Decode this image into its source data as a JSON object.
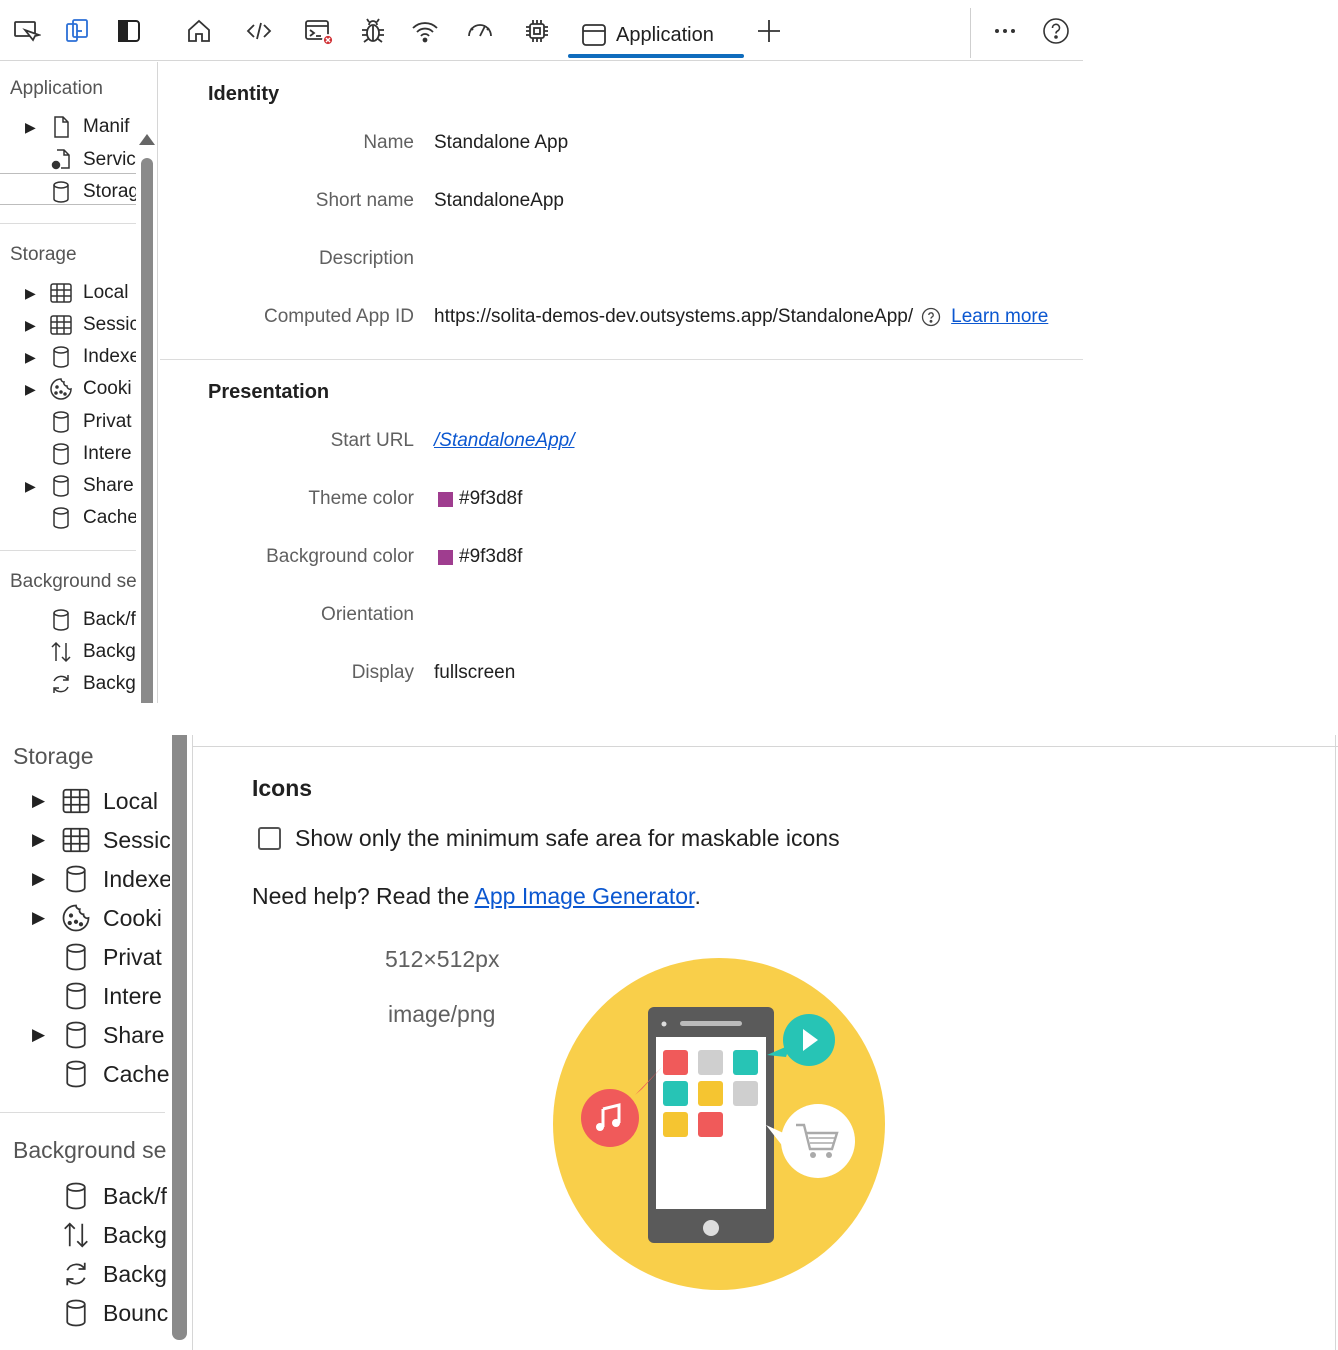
{
  "toolbar": {
    "active_tab_label": "Application",
    "icons": [
      "inspect-icon",
      "device-emulation-icon",
      "dock-sidebar-icon",
      "welcome-home-icon",
      "elements-code-icon",
      "console-icon",
      "sources-bug-icon",
      "network-wifi-icon",
      "performance-gauge-icon",
      "memory-chip-icon",
      "application-window-icon",
      "add-tab-icon",
      "more-options-icon",
      "help-icon"
    ]
  },
  "sidebar": {
    "sections": [
      {
        "heading": "Application",
        "items": [
          {
            "label": "Manif",
            "icon": "document-icon",
            "expandable": true
          },
          {
            "label": "Servic",
            "icon": "service-worker-icon",
            "expandable": false
          },
          {
            "label": "Storag",
            "icon": "database-icon",
            "expandable": false
          }
        ]
      },
      {
        "heading": "Storage",
        "items": [
          {
            "label": "Local",
            "icon": "grid-table-icon",
            "expandable": true
          },
          {
            "label": "Sessic",
            "icon": "grid-table-icon",
            "expandable": true
          },
          {
            "label": "Indexe",
            "icon": "database-icon",
            "expandable": true
          },
          {
            "label": "Cooki",
            "icon": "cookie-icon",
            "expandable": true
          },
          {
            "label": "Privat",
            "icon": "database-icon",
            "expandable": false
          },
          {
            "label": "Intere",
            "icon": "database-icon",
            "expandable": false
          },
          {
            "label": "Share",
            "icon": "database-icon",
            "expandable": true
          },
          {
            "label": "Cache",
            "icon": "database-icon",
            "expandable": false
          }
        ]
      },
      {
        "heading": "Background se",
        "items": [
          {
            "label": "Back/f",
            "icon": "database-icon",
            "expandable": false
          },
          {
            "label": "Backg",
            "icon": "up-down-arrows-icon",
            "expandable": false
          },
          {
            "label": "Backg",
            "icon": "sync-icon",
            "expandable": false
          },
          {
            "label": "Bounc",
            "icon": "database-icon",
            "expandable": false
          }
        ]
      }
    ]
  },
  "identity": {
    "title": "Identity",
    "name_label": "Name",
    "name_value": "Standalone App",
    "short_name_label": "Short name",
    "short_name_value": "StandaloneApp",
    "description_label": "Description",
    "description_value": "",
    "app_id_label": "Computed App ID",
    "app_id_value": "https://solita-demos-dev.outsystems.app/StandaloneApp/",
    "learn_more": "Learn more"
  },
  "presentation": {
    "title": "Presentation",
    "start_url_label": "Start URL",
    "start_url_value": "/StandaloneApp/",
    "theme_color_label": "Theme color",
    "theme_color_value": "#9f3d8f",
    "background_color_label": "Background color",
    "background_color_value": "#9f3d8f",
    "orientation_label": "Orientation",
    "orientation_value": "",
    "display_label": "Display",
    "display_value": "fullscreen"
  },
  "icons_section": {
    "title": "Icons",
    "checkbox_label": "Show only the minimum safe area for maskable icons",
    "checkbox_checked": false,
    "help_prefix": "Need help? Read the ",
    "help_link": "App Image Generator",
    "help_suffix": ".",
    "icon_size": "512×512px",
    "icon_type": "image/png"
  },
  "colors": {
    "accent": "#0f6cbd",
    "link": "#0b57d0",
    "swatch": "#9f3d8f",
    "icon_circle": "#f9cf4a"
  }
}
